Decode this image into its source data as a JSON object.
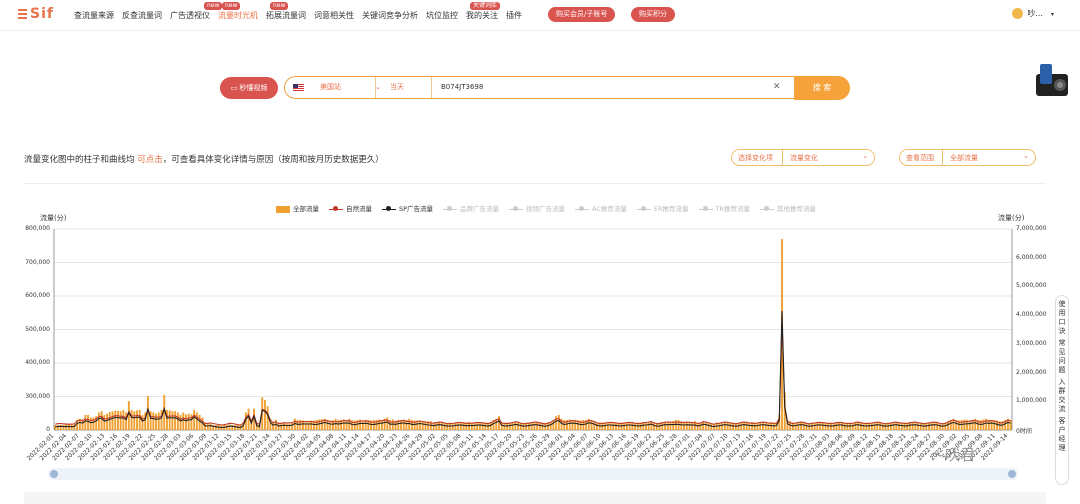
{
  "app": {
    "logo": "Sif"
  },
  "nav": {
    "items": [
      {
        "label": "查流量来源"
      },
      {
        "label": "反查流量词"
      },
      {
        "label": "广告透视仪"
      },
      {
        "label": "流量时光机",
        "active": true,
        "badge": "new"
      },
      {
        "label": "拓展流量词",
        "badge": "new"
      },
      {
        "label": "词意相关性"
      },
      {
        "label": "关键词竞争分析"
      },
      {
        "label": "坑位监控"
      },
      {
        "label": "我的关注",
        "badge": "关键词库"
      },
      {
        "label": "插件"
      }
    ],
    "badge_ad": "new",
    "btn_buy_member": "购买会员/子账号",
    "btn_buy_points": "购买积分",
    "user_name": "吵..."
  },
  "search": {
    "video_btn": "秒懂视频",
    "country": "美国站",
    "period": "当天",
    "asin": "B074JT3698",
    "search_btn": "搜 索"
  },
  "desc": {
    "prefix": "流量变化图中的柱子和曲线均",
    "highlight": "可点击",
    "suffix": "，可查看具体变化详情与原因（按周和按月历史数据更久）"
  },
  "filters": {
    "change_label": "选择变化项",
    "change_value": "流量变化",
    "scope_label": "查看范围",
    "scope_value": "全部流量"
  },
  "colors": {
    "bar": "#f0a030",
    "natural": "#c0392b",
    "sp": "#222222",
    "accent": "#e8734a"
  },
  "chart_data": {
    "type": "bar",
    "legend": [
      {
        "name": "全部流量",
        "kind": "bar",
        "on": true
      },
      {
        "name": "自然流量",
        "kind": "line",
        "on": true,
        "color": "#c0392b"
      },
      {
        "name": "SP广告流量",
        "kind": "line",
        "on": true,
        "color": "#222222"
      },
      {
        "name": "品牌广告流量",
        "kind": "line",
        "on": false
      },
      {
        "name": "视频广告流量",
        "kind": "line",
        "on": false
      },
      {
        "name": "AC推荐流量",
        "kind": "line",
        "on": false
      },
      {
        "name": "ER推荐流量",
        "kind": "line",
        "on": false
      },
      {
        "name": "TR推荐流量",
        "kind": "line",
        "on": false
      },
      {
        "name": "其他推荐流量",
        "kind": "line",
        "on": false
      }
    ],
    "ylabel_left": "流量(分)",
    "ylabel_right": "流量(分)",
    "yticks_left": [
      "800,000",
      "700,000",
      "600,000",
      "500,000",
      "400,000",
      "300,000",
      "0"
    ],
    "yticks_right": [
      "7,000,000",
      "6,000,000",
      "5,000,000",
      "4,000,000",
      "3,000,000",
      "2,000,000",
      "1,000,000",
      "0时间"
    ],
    "ylim_left": [
      0,
      800000
    ],
    "xtick_labels": [
      "2022-02-01",
      "2022-02-04",
      "2022-02-07",
      "2022-02-10",
      "2022-02-13",
      "2022-02-16",
      "2022-02-19",
      "2022-02-22",
      "2022-02-25",
      "2022-02-28",
      "2022-03-03",
      "2022-03-06",
      "2022-03-09",
      "2022-03-12",
      "2022-03-15",
      "2022-03-18",
      "2022-03-21",
      "2022-03-24",
      "2022-03-27",
      "2022-03-30",
      "2022-04-02",
      "2022-04-05",
      "2022-04-08",
      "2022-04-11",
      "2022-04-14",
      "2022-04-17",
      "2022-04-20",
      "2022-04-23",
      "2022-04-26",
      "2022-04-29",
      "2022-05-02",
      "2022-05-05",
      "2022-05-08",
      "2022-05-11",
      "2022-05-14",
      "2022-05-17",
      "2022-05-20",
      "2022-05-23",
      "2022-05-26",
      "2022-05-29",
      "2022-06-01",
      "2022-06-04",
      "2022-06-07",
      "2022-06-10",
      "2022-06-13",
      "2022-06-16",
      "2022-06-19",
      "2022-06-22",
      "2022-06-25",
      "2022-06-28",
      "2022-07-01",
      "2022-07-04",
      "2022-07-07",
      "2022-07-10",
      "2022-07-13",
      "2022-07-16",
      "2022-07-19",
      "2022-07-22",
      "2022-07-25",
      "2022-07-28",
      "2022-07-31",
      "2022-08-03",
      "2022-08-06",
      "2022-08-09",
      "2022-08-12",
      "2022-08-15",
      "2022-08-18",
      "2022-08-21",
      "2022-08-24",
      "2022-08-27",
      "2022-08-30",
      "2022-09-02",
      "2022-09-05",
      "2022-09-08",
      "2022-09-11",
      "2022-09-14"
    ],
    "series_total": [
      20000,
      20000,
      20000,
      20000,
      25000,
      25000,
      25000,
      22000,
      40000,
      45000,
      42000,
      60000,
      60000,
      50000,
      50000,
      55000,
      70000,
      75000,
      60000,
      65000,
      72000,
      74000,
      77000,
      76000,
      75000,
      80000,
      70000,
      115000,
      80000,
      75000,
      78000,
      80000,
      60000,
      70000,
      135000,
      75000,
      70000,
      65000,
      70000,
      80000,
      140000,
      80000,
      78000,
      75000,
      75000,
      70000,
      60000,
      70000,
      62000,
      65000,
      62000,
      80000,
      70000,
      60000,
      50000,
      30000,
      25000,
      25000,
      20000,
      20000,
      20000,
      20000,
      20000,
      20000,
      22000,
      20000,
      20000,
      20000,
      20000,
      30000,
      70000,
      85000,
      40000,
      85000,
      30000,
      25000,
      130000,
      120000,
      95000,
      45000,
      30000,
      40000,
      30000,
      30000,
      30000,
      25000,
      25000,
      30000,
      45000,
      40000,
      40000,
      38000,
      35000,
      35000,
      38000,
      38000,
      40000,
      42000,
      43000,
      45000,
      40000,
      38000,
      40000,
      45000,
      40000,
      40000,
      42000,
      40000,
      45000,
      38000,
      38000,
      40000,
      42000,
      38000,
      40000,
      40000,
      38000,
      40000,
      40000,
      42000,
      40000,
      45000,
      50000,
      40000,
      42000,
      38000,
      40000,
      40000,
      42000,
      40000,
      45000,
      40000,
      38000,
      38000,
      38000,
      35000,
      35000,
      35000,
      35000,
      30000,
      30000,
      30000,
      30000,
      28000,
      28000,
      30000,
      28000,
      28000,
      28000,
      28000,
      30000,
      30000,
      32000,
      30000,
      28000,
      28000,
      28000,
      30000,
      30000,
      30000,
      32000,
      40000,
      45000,
      55000,
      30000,
      30000,
      30000,
      30000,
      30000,
      32000,
      30000,
      28000,
      28000,
      30000,
      30000,
      30000,
      30000,
      30000,
      30000,
      30000,
      28000,
      30000,
      32000,
      40000,
      55000,
      60000,
      45000,
      40000,
      40000,
      42000,
      40000,
      40000,
      40000,
      38000,
      40000,
      40000,
      45000,
      40000,
      35000,
      30000,
      30000,
      30000,
      30000,
      30000,
      28000,
      28000,
      30000,
      30000,
      30000,
      30000,
      30000,
      28000,
      28000,
      28000,
      30000,
      30000,
      32000,
      30000,
      30000,
      35000,
      30000,
      28000,
      30000,
      32000,
      32000,
      30000,
      32000,
      35000,
      40000,
      40000,
      35000,
      30000,
      30000,
      30000,
      32000,
      35000,
      30000,
      30000,
      35000,
      30000,
      28000,
      25000,
      25000,
      30000,
      28000,
      30000,
      30000,
      30000,
      30000,
      30000,
      28000,
      28000,
      30000,
      30000,
      30000,
      30000,
      32000,
      30000,
      30000,
      30000,
      30000,
      30000,
      30000,
      32000,
      30000,
      30000,
      60000,
      760000,
      150000,
      40000,
      35000,
      30000,
      30000,
      30000,
      30000,
      30000,
      28000,
      28000,
      30000,
      30000,
      30000,
      28000,
      28000,
      30000,
      30000,
      30000,
      28000,
      28000,
      28000,
      30000,
      28000,
      30000,
      30000,
      28000,
      30000,
      30000,
      28000,
      28000,
      30000,
      30000,
      30000,
      28000,
      30000,
      30000,
      28000,
      28000,
      30000,
      30000,
      30000,
      30000,
      28000,
      30000,
      30000,
      30000,
      32000,
      30000,
      30000,
      28000,
      30000,
      28000,
      30000,
      30000,
      30000,
      30000,
      30000,
      28000,
      28000,
      30000,
      35000,
      40000,
      45000,
      40000,
      38000,
      40000,
      42000,
      40000,
      38000,
      40000,
      45000,
      40000,
      40000,
      42000,
      45000,
      40000,
      40000,
      40000,
      38000,
      35000,
      35000,
      40000,
      45000,
      40000
    ]
  },
  "side": {
    "items": [
      "使用口诀",
      "常见问题",
      "入群交流",
      "客户经理"
    ]
  },
  "watermark": "〜吠君"
}
